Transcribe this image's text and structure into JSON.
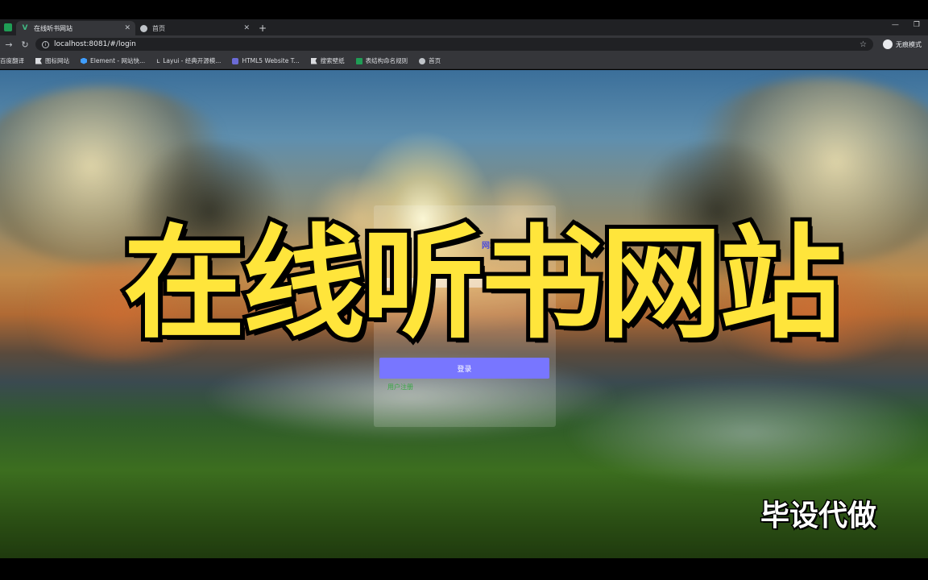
{
  "browser": {
    "tabs": [
      {
        "label": "在线听书网站",
        "active": true
      },
      {
        "label": "首页",
        "active": false
      }
    ],
    "new_tab": "+",
    "address": "localhost:8081/#/login",
    "profile": "无痕模式",
    "bookmarks": [
      {
        "label": "百度翻译",
        "icon": "bookmark-icon"
      },
      {
        "label": "图标网站",
        "icon": "flag-icon"
      },
      {
        "label": "Element - 网站快...",
        "icon": "element-icon"
      },
      {
        "label": "Layui - 经典开源模...",
        "icon": "layui-icon"
      },
      {
        "label": "HTML5 Website T...",
        "icon": "html5-icon"
      },
      {
        "label": "搜索壁纸",
        "icon": "wallpaper-icon"
      },
      {
        "label": "表结构命名规则",
        "icon": "doc-icon"
      },
      {
        "label": "首页",
        "icon": "globe-icon"
      }
    ]
  },
  "login": {
    "title": "网站",
    "button_label": "登录",
    "register_link": "用户注册"
  },
  "overlay": {
    "headline": "在线听书网站",
    "watermark": "毕设代做",
    "headline_color": "#ffe53b"
  },
  "colors": {
    "button": "#7876ff",
    "title": "#4d4bd9",
    "link": "#3aa845"
  }
}
